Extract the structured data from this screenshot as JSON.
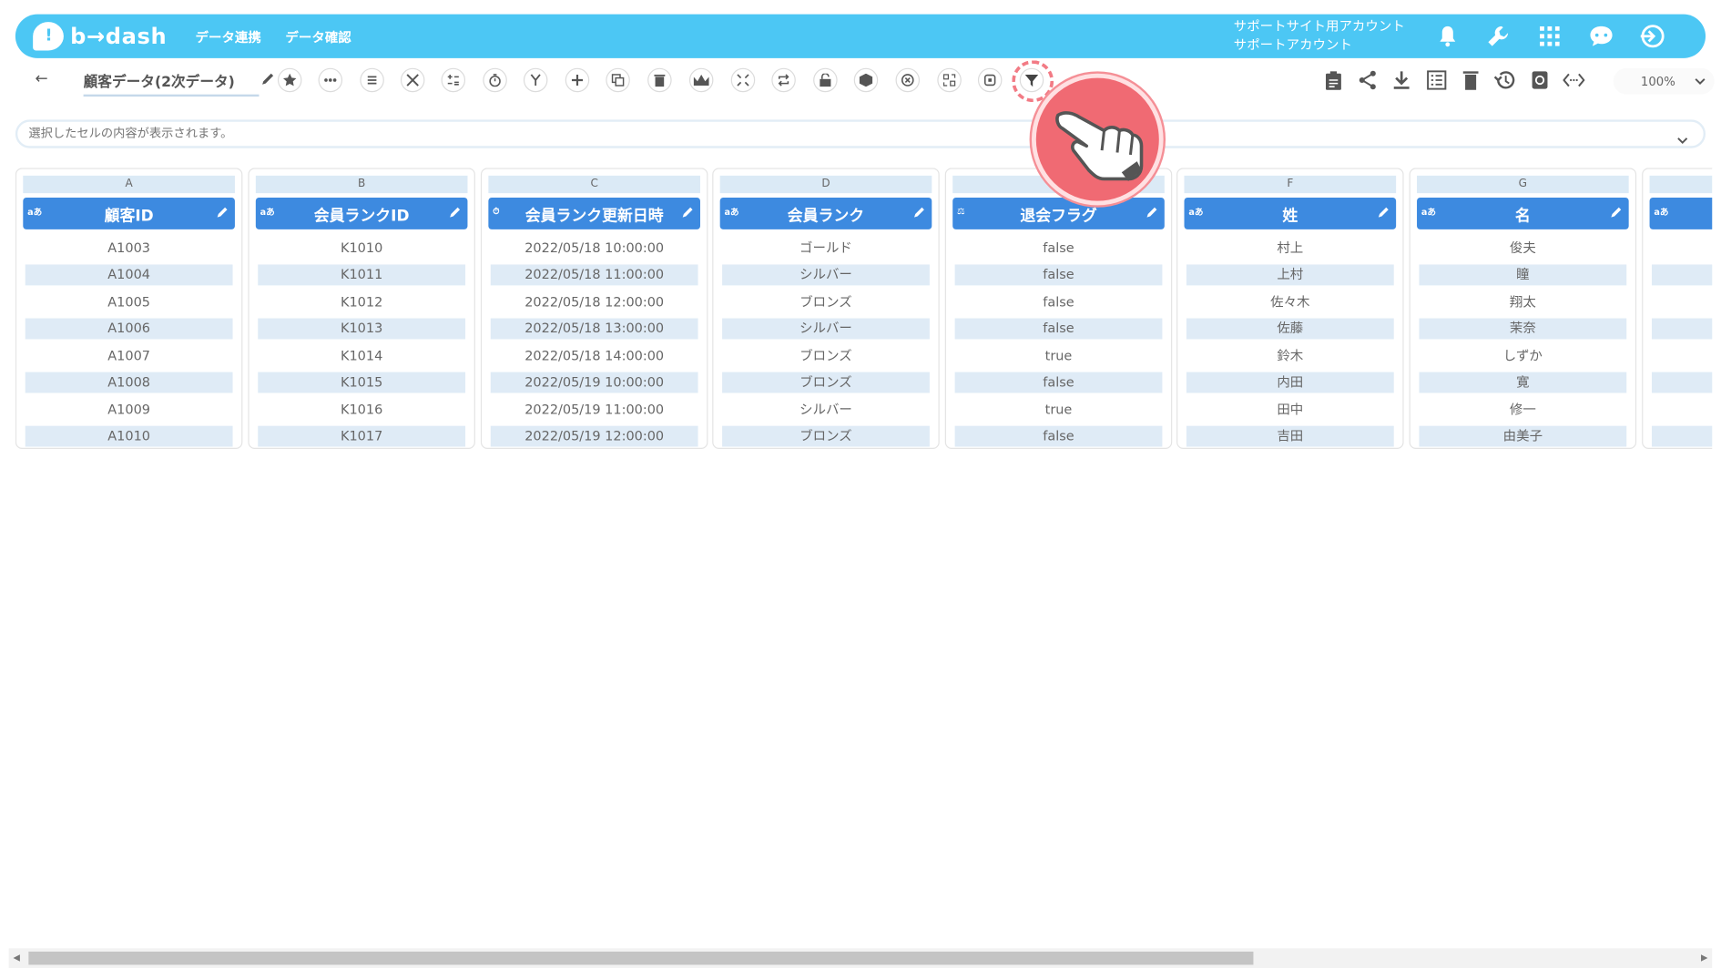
{
  "header": {
    "brand": "b→dash",
    "nav": [
      "データ連携",
      "データ確認"
    ],
    "account_line1": "サポートサイト用アカウント",
    "account_line2": "サポートアカウント"
  },
  "toolbar": {
    "back_label": "←",
    "data_name": "顧客データ(2次データ)",
    "zoom": "100%"
  },
  "cell_content": {
    "placeholder": "選択したセルの内容が表示されます。"
  },
  "columns": [
    {
      "letter": "A",
      "type": "aあ",
      "title": "顧客ID",
      "cells": [
        "A1003",
        "A1004",
        "A1005",
        "A1006",
        "A1007",
        "A1008",
        "A1009",
        "A1010"
      ]
    },
    {
      "letter": "B",
      "type": "aあ",
      "title": "会員ランクID",
      "cells": [
        "K1010",
        "K1011",
        "K1012",
        "K1013",
        "K1014",
        "K1015",
        "K1016",
        "K1017"
      ]
    },
    {
      "letter": "C",
      "type": "⏱",
      "title": "会員ランク更新日時",
      "cells": [
        "2022/05/18 10:00:00",
        "2022/05/18 11:00:00",
        "2022/05/18 12:00:00",
        "2022/05/18 13:00:00",
        "2022/05/18 14:00:00",
        "2022/05/19 10:00:00",
        "2022/05/19 11:00:00",
        "2022/05/19 12:00:00"
      ]
    },
    {
      "letter": "D",
      "type": "aあ",
      "title": "会員ランク",
      "cells": [
        "ゴールド",
        "シルバー",
        "ブロンズ",
        "シルバー",
        "ブロンズ",
        "ブロンズ",
        "シルバー",
        "ブロンズ"
      ]
    },
    {
      "letter": "",
      "type": "⚖",
      "title": "退会フラグ",
      "cells": [
        "false",
        "false",
        "false",
        "false",
        "true",
        "false",
        "true",
        "false"
      ]
    },
    {
      "letter": "F",
      "type": "aあ",
      "title": "姓",
      "cells": [
        "村上",
        "上村",
        "佐々木",
        "佐藤",
        "鈴木",
        "内田",
        "田中",
        "吉田"
      ]
    },
    {
      "letter": "G",
      "type": "aあ",
      "title": "名",
      "cells": [
        "俊夫",
        "瞳",
        "翔太",
        "茉奈",
        "しずか",
        "寛",
        "修一",
        "由美子"
      ]
    },
    {
      "letter": "",
      "type": "aあ",
      "title": "",
      "cells": [
        "",
        "",
        "",
        "",
        "",
        "",
        "",
        ""
      ]
    }
  ],
  "colors": {
    "header_bg": "#4cc7f4",
    "column_header": "#3d8ae0",
    "row_alt": "#dfebf6",
    "tap": "#f06a73"
  }
}
